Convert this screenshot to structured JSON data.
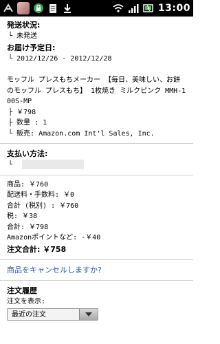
{
  "status_bar": {
    "time": "13:00",
    "icons": [
      "notification-icon",
      "avatar",
      "lock-icon",
      "clipboard-icon",
      "download-icon",
      "wifi-icon",
      "signal-icon",
      "battery-icon"
    ]
  },
  "shipping": {
    "status_label": "発送状況:",
    "status_value": "└ 未発送",
    "delivery_label": "お届け予定日:",
    "delivery_value": "└ 2012/12/26 - 2012/12/28"
  },
  "item": {
    "title": "モッフル プレスもちメーカー 【毎日、美味しい、お餅のモッフル プレスもち】 1枚焼き ミルクピンク MMH-100S-MP",
    "price": "├ ￥798",
    "quantity": "├ 数量 : 1",
    "seller": "└ 販売: Amazon.com Int'l Sales, Inc."
  },
  "payment": {
    "label": "支払い方法:",
    "value_prefix": "└"
  },
  "totals": {
    "subtotal": "商品: ￥760",
    "shipping_fee": "配送料・手数料: ￥0",
    "pre_tax": "合計 (税別) : ￥760",
    "tax": "税: ￥38",
    "total": "合計: ￥798",
    "points": "Amazonポイントなど: -￥40",
    "order_total": "注文合計: ￥758"
  },
  "cancel_link": "商品をキャンセルしますか?",
  "history": {
    "heading": "注文履歴",
    "filter_label": "注文を表示:",
    "filter_selected": "最近の注文"
  }
}
